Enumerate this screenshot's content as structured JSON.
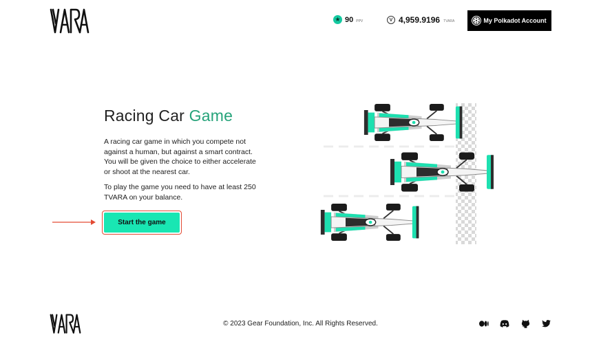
{
  "header": {
    "ppv_value": "90",
    "ppv_unit": "PPV",
    "balance_value": "4,959.9196",
    "balance_unit": "TVARA",
    "account_button_label": "My Polkadot Account"
  },
  "main": {
    "title_primary": "Racing Car",
    "title_accent": "Game",
    "description": "A racing car game in which you compete not against a human, but against a smart contract. You will be given the choice to either accelerate or shoot at the nearest car.",
    "requirement": "To play the game you need to have at least 250 TVARA on your balance.",
    "start_button_label": "Start the game"
  },
  "footer": {
    "copyright": "© 2023 Gear Foundation, Inc. All Rights Reserved.",
    "socials": [
      "medium-icon",
      "discord-icon",
      "github-icon",
      "twitter-icon"
    ]
  },
  "colors": {
    "accent": "#19e6b3",
    "title_accent": "#26a37a",
    "highlight": "#e34a33",
    "dark": "#000000"
  }
}
